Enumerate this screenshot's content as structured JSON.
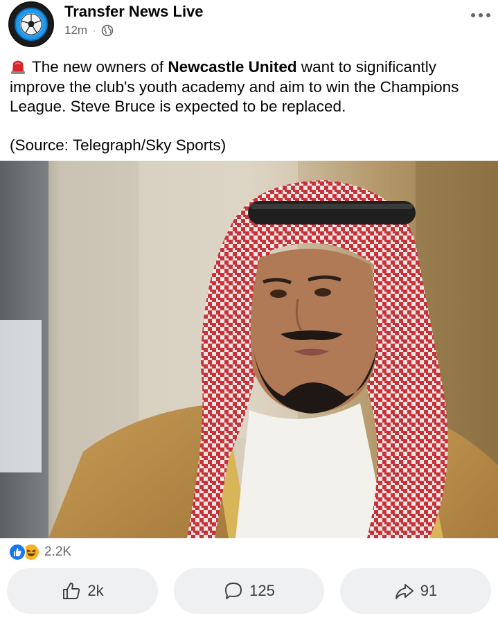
{
  "post": {
    "page_name": "Transfer News Live",
    "time": "12m",
    "separator": "·",
    "audience_icon": "globe-icon",
    "more_icon": "more-options-icon",
    "text_emoji": "siren-emoji",
    "text_before": "The new owners of ",
    "text_bold": "Newcastle United",
    "text_after": " want to significantly improve the club's youth academy and aim to win the Champions League. Steve Bruce is expected to be replaced.",
    "source": "(Source: Telegraph/Sky Sports)"
  },
  "reactions": {
    "icons": [
      "like-reaction-icon",
      "haha-reaction-icon"
    ],
    "count": "2.2K"
  },
  "actions": {
    "like": {
      "icon": "thumbs-up-icon",
      "count": "2k"
    },
    "comment": {
      "icon": "comment-icon",
      "count": "125"
    },
    "share": {
      "icon": "share-icon",
      "count": "91"
    }
  },
  "colors": {
    "like_blue": "#1877f2",
    "haha_yellow": "#f7b125",
    "secondary_text": "#65676b",
    "button_bg": "#eef0f2"
  }
}
